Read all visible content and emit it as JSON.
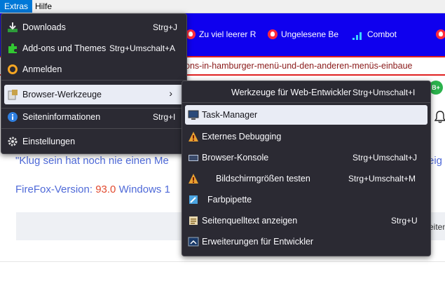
{
  "menubar": {
    "extras": "Extras",
    "hilfe": "Hilfe"
  },
  "bookmarks": [
    {
      "label": "Zu viel leerer R"
    },
    {
      "label": "Ungelesene Be"
    },
    {
      "label": "Combot"
    }
  ],
  "urlbar": {
    "text": "ons-in-hamburger-menü-und-den-anderen-menüs-einbaue"
  },
  "page": {
    "quote": "\"Klug sein hat noch nie einen Me",
    "quote_tail": "eig",
    "ff_prefix": "FireFox-Version: ",
    "ff_version": "93.0",
    "ff_suffix": " Windows 1",
    "gray_tail": "eiten",
    "addon_badge": "B+"
  },
  "extras_menu": [
    {
      "label": "Downloads",
      "shortcut": "Strg+J",
      "icon": "download-icon"
    },
    {
      "label": "Add-ons und Themes",
      "shortcut": "Strg+Umschalt+A",
      "icon": "puzzle-icon"
    },
    {
      "label": "Anmelden",
      "shortcut": "",
      "icon": "account-icon"
    },
    {
      "label": "Browser-Werkzeuge",
      "shortcut": "",
      "icon": "toolbox-icon"
    },
    {
      "label": "Seiteninformationen",
      "shortcut": "Strg+I",
      "icon": "info-icon"
    },
    {
      "label": "Einstellungen",
      "shortcut": "",
      "icon": "gear-icon"
    }
  ],
  "tools_menu": [
    {
      "label": "Werkzeuge für Web-Entwickler",
      "shortcut": "Strg+Umschalt+I",
      "icon": ""
    },
    {
      "label": "Task-Manager",
      "shortcut": "",
      "icon": "monitor-icon"
    },
    {
      "label": "Externes Debugging",
      "shortcut": "",
      "icon": "warning-icon"
    },
    {
      "label": "Browser-Konsole",
      "shortcut": "Strg+Umschalt+J",
      "icon": "console-icon"
    },
    {
      "label": "Bildschirmgrößen testen",
      "shortcut": "Strg+Umschalt+M",
      "icon": "warning-icon"
    },
    {
      "label": "Farbpipette",
      "shortcut": "",
      "icon": "eyedropper-icon"
    },
    {
      "label": "Seitenquelltext anzeigen",
      "shortcut": "Strg+U",
      "icon": "source-icon"
    },
    {
      "label": "Erweiterungen für Entwickler",
      "shortcut": "",
      "icon": "extension-dev-icon"
    }
  ],
  "colors": {
    "menu_bg": "#2b2a33",
    "menu_text": "#fbfbfe",
    "highlight": "#e9ecf5",
    "bookmarks_bar": "#0f00ee",
    "url_border": "#e02020",
    "link_blue": "#4f6ad8",
    "version_red": "#e24a2f"
  }
}
